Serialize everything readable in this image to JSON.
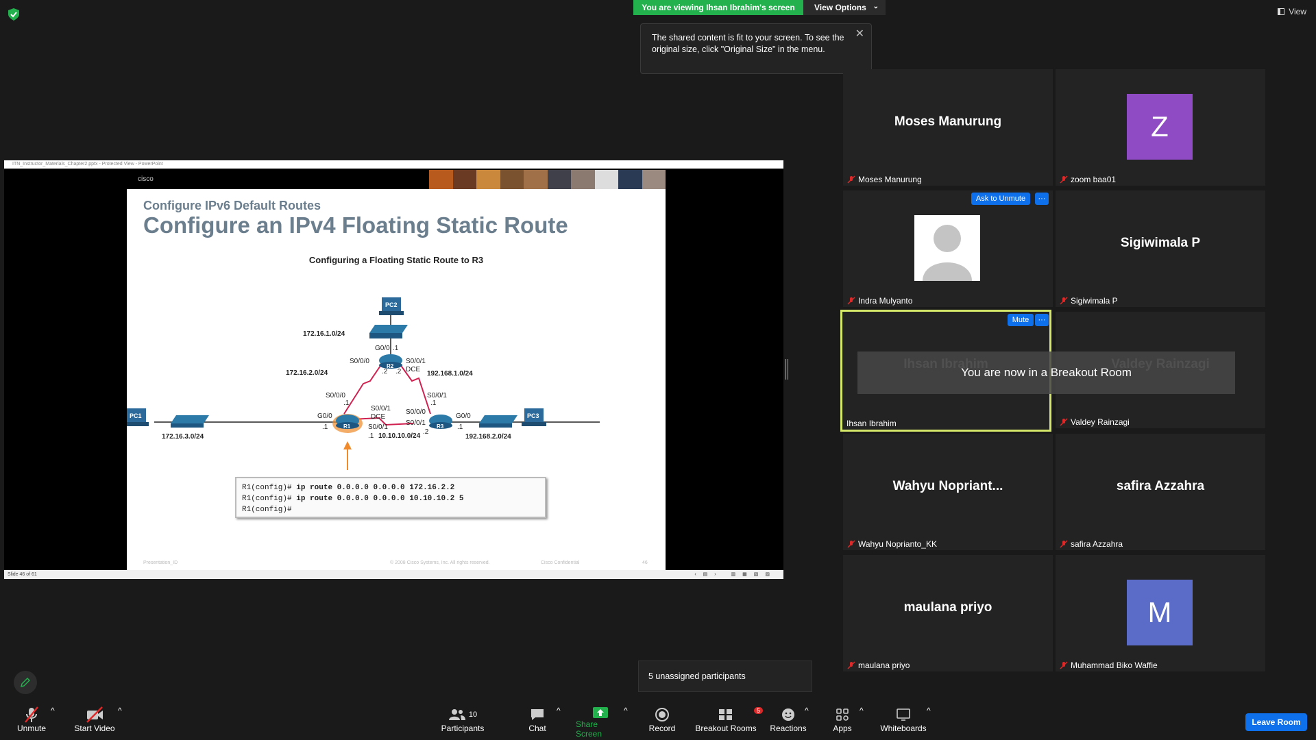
{
  "top": {
    "viewing_banner": "You are viewing Ihsan Ibrahim's screen",
    "view_options": "View Options",
    "view_label": "View",
    "tooltip": "The shared content is fit to your screen. To see the original size, click \"Original Size\" in the menu."
  },
  "share": {
    "window_title": "ITN_Instructor_Materials_Chapter2.pptx - Protected View - PowerPoint",
    "status": "Slide 46 of 61",
    "logo_text": "cisco",
    "slide": {
      "subtitle": "Configure IPv6 Default Routes",
      "title": "Configure an IPv4 Floating Static Route",
      "figure_title": "Configuring a Floating Static Route to R3",
      "footer_left": "Presentation_ID",
      "footer_mid": "© 2008 Cisco Systems, Inc. All rights reserved.",
      "footer_conf": "Cisco Confidential",
      "page_number": "46",
      "cli_prompt": "R1(config)#",
      "cli_cmd1": "ip route 0.0.0.0 0.0.0.0 172.16.2.2",
      "cli_cmd2": "ip route 0.0.0.0 0.0.0.0 10.10.10.2 5",
      "diagram": {
        "pc2": "PC2",
        "pc1": "PC1",
        "pc3": "PC3",
        "r1": "R1",
        "r2": "R2",
        "r3": "R3",
        "net_top": "172.16.1.0/24",
        "net_left": "172.16.2.0/24",
        "net_right": "192.168.1.0/24",
        "net_pc1": "172.16.3.0/24",
        "net_mid": "10.10.10.0/24",
        "net_pc3": "192.168.2.0/24",
        "g00": "G0/0",
        "s000": "S0/0/0",
        "s001": "S0/0/1",
        "dce": "DCE",
        "d1": ".1",
        "d2": ".2"
      }
    }
  },
  "participants": [
    {
      "display": "Moses Manurung",
      "name": "Moses Manurung",
      "type": "text"
    },
    {
      "display": "Z",
      "name": "zoom baa01",
      "type": "letter",
      "color": "#8e4bc4"
    },
    {
      "display": "",
      "name": "Indra Mulyanto",
      "type": "photo"
    },
    {
      "display": "Sigiwimala P",
      "name": "Sigiwimala P",
      "type": "text"
    },
    {
      "display": "Ihsan Ibrahim",
      "name": "Ihsan Ibrahim",
      "type": "active"
    },
    {
      "display": "Valdey Rainzagi",
      "name": "Valdey Rainzagi",
      "type": "text"
    },
    {
      "display": "Wahyu  Nopriant...",
      "name": "Wahyu Noprianto_KK",
      "type": "text"
    },
    {
      "display": "safira Azzahra",
      "name": "safira Azzahra",
      "type": "text"
    },
    {
      "display": "maulana priyo",
      "name": "maulana priyo",
      "type": "text"
    },
    {
      "display": "M",
      "name": "Muhammad Biko Waffie",
      "type": "letter",
      "color": "#5b6bc8"
    }
  ],
  "tile_buttons": {
    "ask_to_unmute": "Ask to Unmute",
    "mute": "Mute",
    "more": "···"
  },
  "breakout_message": "You are now in a Breakout Room",
  "unassigned": "5 unassigned participants",
  "toolbar": {
    "unmute": "Unmute",
    "start_video": "Start Video",
    "participants": "Participants",
    "participants_count": "10",
    "chat": "Chat",
    "share_screen": "Share Screen",
    "record": "Record",
    "breakout_rooms": "Breakout Rooms",
    "breakout_badge": "5",
    "reactions": "Reactions",
    "apps": "Apps",
    "whiteboards": "Whiteboards",
    "leave_room": "Leave Room"
  },
  "colors": {
    "accent_blue": "#0e71eb",
    "green": "#23b14d",
    "active_border": "#d6e86a",
    "muted_red": "#e02828"
  }
}
